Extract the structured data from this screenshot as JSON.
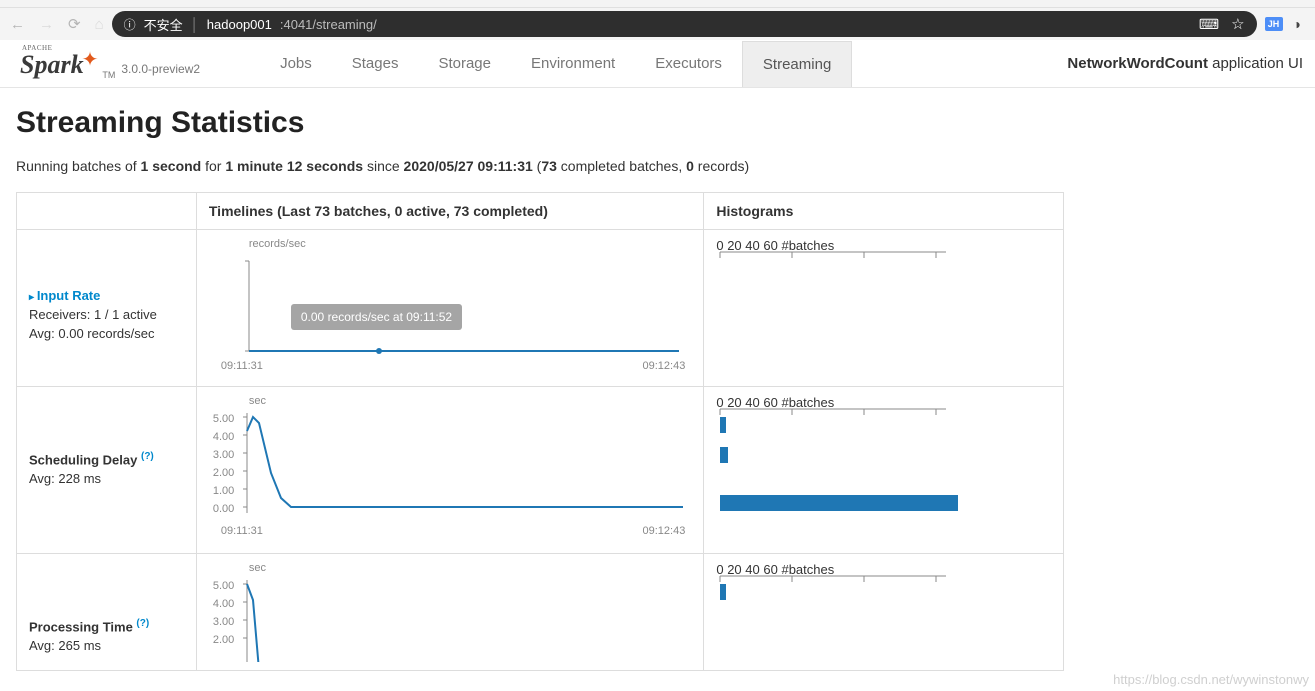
{
  "browser": {
    "insecure_label": "不安全",
    "url_host": "hadoop001",
    "url_port_path": ":4041/streaming/",
    "ext_badge": "JH"
  },
  "header": {
    "logo_apache": "APACHE",
    "logo_word": "Spark",
    "logo_tm": "TM",
    "version": "3.0.0-preview2",
    "tabs": [
      "Jobs",
      "Stages",
      "Storage",
      "Environment",
      "Executors",
      "Streaming"
    ],
    "active_tab_index": 5,
    "app_name": "NetworkWordCount",
    "app_suffix": " application UI"
  },
  "page": {
    "title": "Streaming Statistics",
    "running_prefix": "Running batches of ",
    "batch_interval": "1 second",
    "for_label": " for ",
    "uptime": "1 minute 12 seconds",
    "since_label": " since ",
    "start_time": "2020/05/27 09:11:31",
    "paren_open": " (",
    "completed_count": "73",
    "completed_label": " completed batches, ",
    "records_count": "0",
    "records_label": " records)"
  },
  "table": {
    "timeline_header": "Timelines (Last 73 batches, 0 active, 73 completed)",
    "histogram_header": "Histograms",
    "batches_label": "#batches",
    "hist_ticks": [
      "0",
      "20",
      "40",
      "60"
    ]
  },
  "rows": {
    "input_rate": {
      "name": "Input Rate",
      "receivers": "Receivers: 1 / 1 active",
      "avg": "Avg: 0.00 records/sec",
      "yunit": "records/sec",
      "x_start": "09:11:31",
      "x_end": "09:12:43",
      "tooltip": "0.00 records/sec at 09:11:52"
    },
    "sched": {
      "name": "Scheduling Delay ",
      "help": "(?)",
      "avg": "Avg: 228 ms",
      "yunit": "sec",
      "yticks": [
        "5.00",
        "4.00",
        "3.00",
        "2.00",
        "1.00",
        "0.00"
      ],
      "x_start": "09:11:31",
      "x_end": "09:12:43"
    },
    "proc": {
      "name": "Processing Time ",
      "help": "(?)",
      "avg": "Avg: 265 ms",
      "yunit": "sec",
      "yticks": [
        "5.00",
        "4.00",
        "3.00",
        "2.00"
      ]
    }
  },
  "watermark": "https://blog.csdn.net/wywinstonwy",
  "chart_data": [
    {
      "type": "line",
      "title": "Input Rate timeline",
      "xlabel": "time",
      "ylabel": "records/sec",
      "x_range": [
        "09:11:31",
        "09:12:43"
      ],
      "ylim": [
        0,
        1
      ],
      "series": [
        {
          "name": "input rate",
          "approx_constant_value": 0.0,
          "points_visible": 73
        }
      ],
      "annotation_point": {
        "time": "09:11:52",
        "value": 0.0
      }
    },
    {
      "type": "bar",
      "title": "Input Rate histogram",
      "xlabel": "records/sec bin",
      "ylabel": "#batches",
      "ylim": [
        0,
        80
      ],
      "values_note": "no visible bars"
    },
    {
      "type": "line",
      "title": "Scheduling Delay timeline",
      "xlabel": "time",
      "ylabel": "sec",
      "x_range": [
        "09:11:31",
        "09:12:43"
      ],
      "ylim": [
        0,
        5
      ],
      "approx_values_sec": [
        5.0,
        4.8,
        3.0,
        1.2,
        0.3,
        0.0,
        0.0,
        0.0,
        0.0,
        0.0,
        0.0,
        0.0,
        0.0,
        0.0,
        0.0,
        0.0,
        0.0
      ]
    },
    {
      "type": "bar",
      "title": "Scheduling Delay histogram",
      "xlabel": "#batches",
      "ylabel": "delay bin",
      "xlim": [
        0,
        80
      ],
      "bars_approx": [
        {
          "bin": "~5s",
          "count": 1
        },
        {
          "bin": "~3s",
          "count": 1
        },
        {
          "bin": "~0s",
          "count": 66
        }
      ]
    },
    {
      "type": "line",
      "title": "Processing Time timeline (partial)",
      "xlabel": "time",
      "ylabel": "sec",
      "ylim": [
        2,
        5
      ],
      "approx_initial_values_sec": [
        5.0,
        4.2
      ]
    },
    {
      "type": "bar",
      "title": "Processing Time histogram",
      "xlabel": "#batches",
      "ylabel": "time bin",
      "xlim": [
        0,
        80
      ],
      "bars_approx": [
        {
          "bin": "~5s",
          "count": 1
        }
      ]
    }
  ]
}
